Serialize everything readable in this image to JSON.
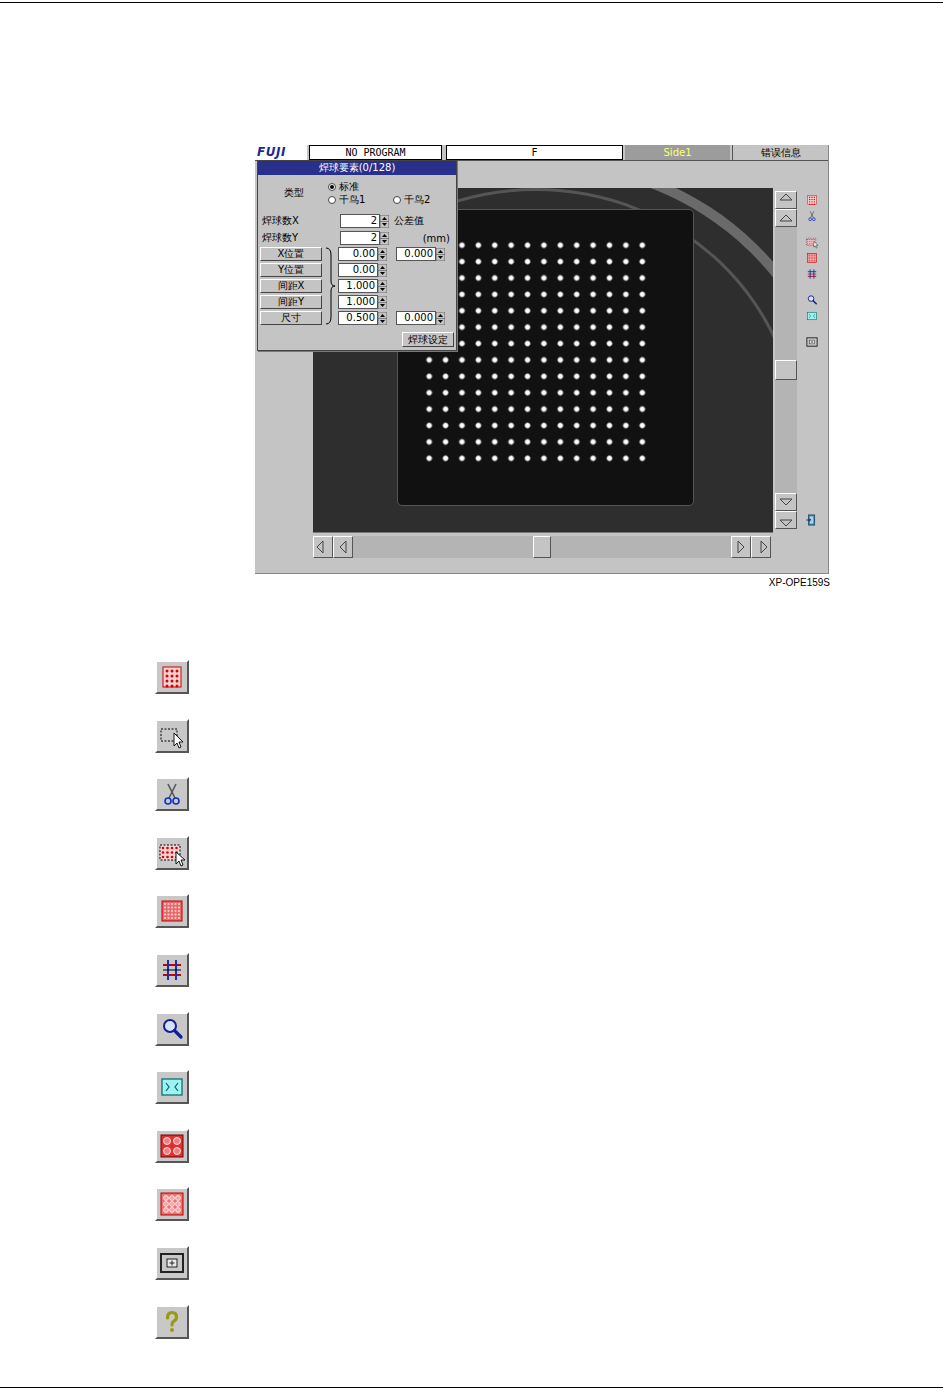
{
  "header": {
    "logo": "FUJI",
    "program": "NO PROGRAM",
    "field": "F",
    "side": "Side1",
    "error_button": "错误信息"
  },
  "dialog": {
    "title": "焊球要素(0/128)",
    "type_label": "类型",
    "types": [
      {
        "label": "标准",
        "selected": true
      },
      {
        "label": "千鸟1",
        "selected": false
      },
      {
        "label": "千鸟2",
        "selected": false
      }
    ],
    "count_rows": [
      {
        "label": "焊球数X",
        "value": "2"
      },
      {
        "label": "焊球数Y",
        "value": "2"
      }
    ],
    "tolerance_label": "公差值",
    "unit": "(mm)",
    "param_rows": [
      {
        "label": "X位置",
        "value": "0.00",
        "tolerance": "0.000"
      },
      {
        "label": "Y位置",
        "value": "0.00"
      },
      {
        "label": "间距X",
        "value": "1.000"
      },
      {
        "label": "间距Y",
        "value": "1.000"
      },
      {
        "label": "尺寸",
        "value": "0.500",
        "tolerance": "0.000"
      }
    ],
    "set_button": "焊球设定"
  },
  "scrollbars": {
    "vertical": {
      "level": 0.54
    },
    "horizontal": {
      "level": 0.5
    }
  },
  "caption": "XP-OPE159S"
}
